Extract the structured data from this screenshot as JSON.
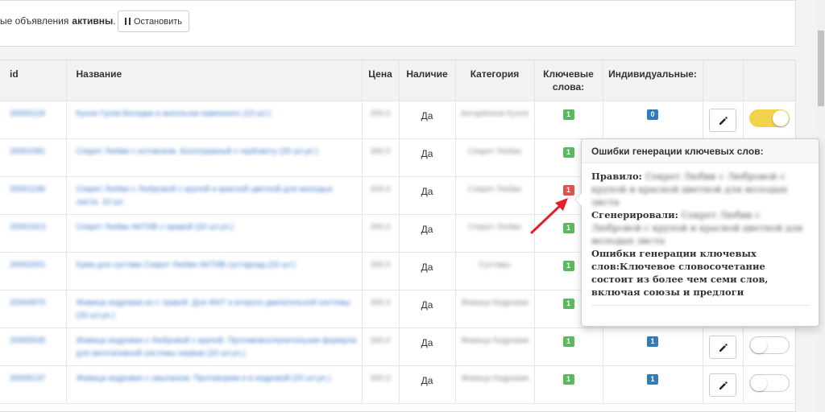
{
  "status_bar": {
    "text": "ые объявления",
    "bold_text": "активны",
    "suffix": ".",
    "stop_button_label": "Остановить"
  },
  "table": {
    "headers": {
      "id": "id",
      "name": "Название",
      "price": "Цена",
      "stock": "Наличие",
      "category": "Категория",
      "keywords": "Ключевые слова:",
      "individual": "Индивидуальные:"
    },
    "rows": [
      {
        "id": "20000118",
        "name": "Кухня Гусев Беседки и ангельски каменного (10 шт.)",
        "price": "200.0",
        "stock": "Да",
        "category": "Ангарбском Кухня",
        "keywords": "1",
        "keywords_status": "ok",
        "individual": "0",
        "toggle": "on"
      },
      {
        "id": "20001081",
        "name": "Секрет Любви с котовском. Болотражный с гербовоту (20 шт.уп.)",
        "price": "300.0",
        "stock": "Да",
        "category": "Секрет Любви",
        "keywords": "1",
        "keywords_status": "ok",
        "individual": "",
        "toggle": ""
      },
      {
        "id": "20001198",
        "name": "Секрет Любви с Любровой с крупой и красной цветной для молодых листа. 10 шт.",
        "price": "200.0",
        "stock": "Да",
        "category": "Секрет Любви",
        "keywords": "1",
        "keywords_status": "error",
        "individual": "",
        "toggle": ""
      },
      {
        "id": "20001913",
        "name": "Секрет Любви АКТИВ с правой (20 шт.уп.)",
        "price": "300.0",
        "stock": "Да",
        "category": "Секрет Любви",
        "keywords": "1",
        "keywords_status": "ok",
        "individual": "",
        "toggle": ""
      },
      {
        "id": "20002001",
        "name": "Кума для сустава Секрет Любви АКТИВ сустархад (20 шт.)",
        "price": "300.0",
        "stock": "Да",
        "category": "Суставы",
        "keywords": "1",
        "keywords_status": "ok",
        "individual": "",
        "toggle": ""
      },
      {
        "id": "20004975",
        "name": "Живица кедровая из с травой. Для ЖКТ и второго двигательной системы (20 шт.уп.)",
        "price": "300.0",
        "stock": "Да",
        "category": "Живица Кедровая",
        "keywords": "1",
        "keywords_status": "ok",
        "individual": "",
        "toggle": ""
      },
      {
        "id": "20005535",
        "name": "Живица кедровая с Любровой с крупой. Противовоспалительная формула для вегетативной системы нервов (20 шт.уп.)",
        "price": "300.0",
        "stock": "Да",
        "category": "Живица Кедровая",
        "keywords": "1",
        "keywords_status": "ok",
        "individual": "1",
        "toggle": "off"
      },
      {
        "id": "20005137",
        "name": "Живица кедровая с овыпаном. Противорим и в кедровой (20 шт.уп.)",
        "price": "300.0",
        "stock": "Да",
        "category": "Живица Кедровая",
        "keywords": "1",
        "keywords_status": "ok",
        "individual": "1",
        "toggle": "off"
      }
    ]
  },
  "popover": {
    "title": "Ошибки генерации ключевых слов:",
    "rule_label": "Правило:",
    "rule_value": "Секрет Любви с Любровой с крупой и красной цветной для молодых листа",
    "generated_label": "Сгенерировали:",
    "generated_value": "Секрет Любви с Любровой с крупой и красной цветной для молодых листа",
    "errors_label": "Ошибки генерации ключевых слов:",
    "errors_value": "Ключевое словосочетание состоит из более чем семи слов, включая союзы и предлоги"
  },
  "colors": {
    "badge_ok": "#5cb85c",
    "badge_error": "#d9534f",
    "badge_info": "#337ab7",
    "toggle_on": "#f2d14b",
    "annotation_arrow": "#e3202a",
    "link": "#3b78c9"
  },
  "icons": {
    "stop": "pause-icon",
    "edit": "pencil-icon"
  }
}
